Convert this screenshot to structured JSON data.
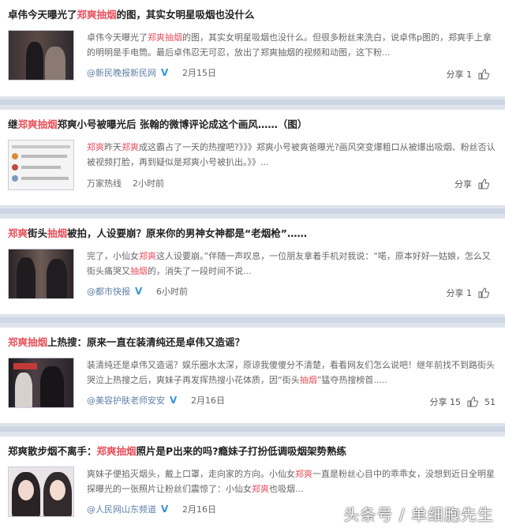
{
  "items": [
    {
      "title_pre": "卓伟今天曝光了",
      "title_kw": "郑爽抽烟",
      "title_post": "的图，其实女明星吸烟也没什么",
      "summary_pre": "卓伟今天曝光了",
      "summary_kw": "郑爽抽烟",
      "summary_post": "的图，其实女明星吸烟也没什么。但很多粉丝来洗白，说卓伟p图的，郑爽手上拿的明明是手电筒。最后卓伟忍无可忍，放出了郑爽抽烟的视频和动图，这下粉...",
      "source": "@新民晚报新民网",
      "verified": "V",
      "time": "2月15日",
      "share": "分享 1",
      "likes": ""
    },
    {
      "title_pre": "继",
      "title_kw": "郑爽抽烟",
      "title_post": "郑爽小号被曝光后 张翰的微博评论成这个画风……（图）",
      "summary_kw1": "郑爽",
      "summary_mid1": "昨天",
      "summary_kw2": "郑爽",
      "summary_post": "成这霸占了一天的热搜吧?》》》郑爽小号被爽爸曝光?画风突变爆粗口从被爆出吸烟、粉丝否认被视频打脸，再到疑似是郑爽小号被扒出。》》...",
      "source": "万家热线",
      "time": "2小时前",
      "share": "分享",
      "likes": ""
    },
    {
      "title_kw1": "郑爽",
      "title_mid": "街头",
      "title_kw2": "抽烟",
      "title_post": "被拍，人设要崩？原来你的男神女神都是“老烟枪”……",
      "summary_pre": "完了，小仙女",
      "summary_kw": "郑爽",
      "summary_mid": "这人设要崩。”伴随一声叹息，一位朋友拿着手机对我说：“喏，原本好好一姑娘，怎么又街头痛哭又",
      "summary_kw2": "抽烟",
      "summary_post": "的，消失了一段时间不说...",
      "source": "@都市快报",
      "verified": "V",
      "time": "6小时前",
      "share": "分享 1",
      "likes": ""
    },
    {
      "title_kw": "郑爽抽烟",
      "title_post": "上热搜：原来一直在装清纯还是卓伟又造谣？",
      "summary_pre": "装清纯还是卓伟又造谣？娱乐圈水太深，原谅我傻傻分不清楚，看看网友们怎么说吧！继年前找不到路街头哭泣上热搜之后，爽妹子再发挥热搜小花体质，因“街头",
      "summary_kw": "抽烟",
      "summary_post": "”猛夺热搜榜首.....",
      "source": "@美容护肤老师安安",
      "verified": "V",
      "time": "2月16日",
      "share": "分享 15",
      "likes": "51"
    },
    {
      "title_pre": "郑爽散步烟不离手：",
      "title_kw": "郑爽抽烟",
      "title_post": "照片是P出来的吗?瘾妹子打扮低调吸烟架势熟练",
      "summary_pre": "爽妹子便掐灭烟头，戴上口罩，走向家的方向。小仙女",
      "summary_kw": "郑爽",
      "summary_mid": "一直是粉丝心目中的乖乖女，没想到近日全明星探曝光的一张照片让粉丝们震惊了：小仙女",
      "summary_kw2": "郑爽",
      "summary_post": "也吸烟...",
      "source": "@人民网山东频道",
      "verified": "V",
      "time": "2月16日",
      "share": "",
      "likes": ""
    }
  ],
  "watermark": "头条号 / 单细胞先生",
  "colors": {
    "keyword": "#e8505b",
    "link": "#5f7fa8",
    "divider": "#cdd6e3"
  }
}
